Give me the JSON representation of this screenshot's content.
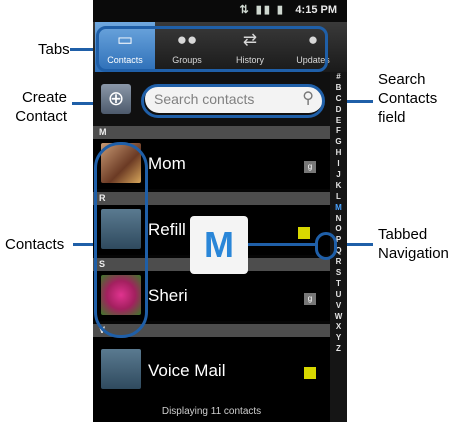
{
  "callouts": {
    "tabs": "Tabs",
    "create_contact": [
      "Create",
      "Contact"
    ],
    "search_contacts_field": [
      "Search",
      "Contacts",
      "field"
    ],
    "contacts": "Contacts",
    "tabbed_navigation": [
      "Tabbed",
      "Navigation"
    ]
  },
  "status_bar": {
    "time": "4:15 PM"
  },
  "tabs": [
    {
      "label": "Contacts",
      "icon": "contacts-icon"
    },
    {
      "label": "Groups",
      "icon": "groups-icon"
    },
    {
      "label": "History",
      "icon": "history-icon"
    },
    {
      "label": "Updates",
      "icon": "updates-icon"
    }
  ],
  "search": {
    "placeholder": "Search contacts"
  },
  "index_letters": [
    "#",
    "B",
    "C",
    "D",
    "E",
    "F",
    "G",
    "H",
    "I",
    "J",
    "K",
    "L",
    "M",
    "N",
    "O",
    "P",
    "Q",
    "R",
    "S",
    "T",
    "U",
    "V",
    "W",
    "X",
    "Y",
    "Z"
  ],
  "sections": [
    "M",
    "R",
    "S",
    "V"
  ],
  "contacts": [
    {
      "name": "Mom",
      "badge": "g"
    },
    {
      "name": "Refill",
      "badge": ""
    },
    {
      "name": "Sheri",
      "badge": "g"
    },
    {
      "name": "Voice Mail",
      "badge": ""
    }
  ],
  "overlay_letter": "M",
  "footer": "Displaying 11 contacts"
}
